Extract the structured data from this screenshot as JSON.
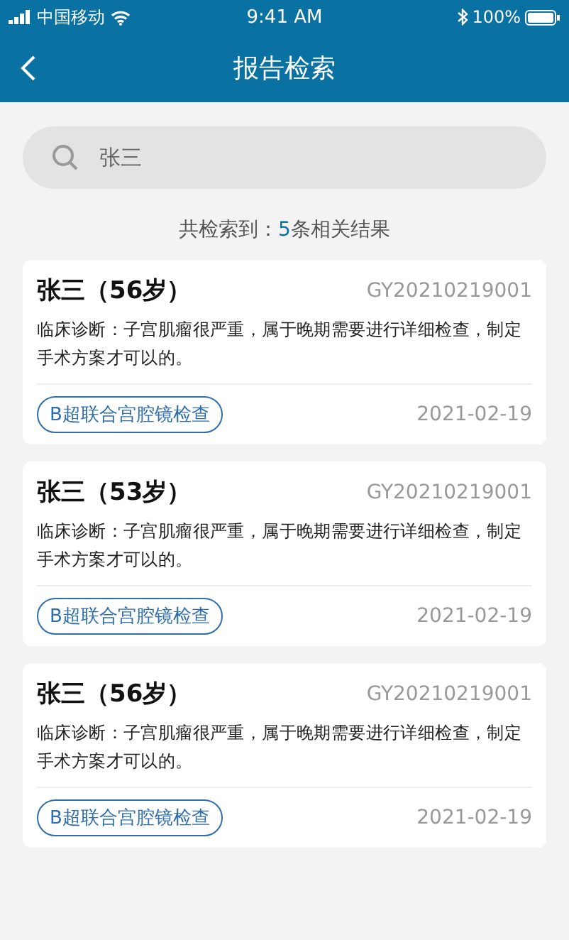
{
  "status_bar": {
    "carrier": "中国移动",
    "time": "9:41 AM",
    "battery": "100%"
  },
  "nav": {
    "title": "报告检索"
  },
  "search": {
    "value": "张三"
  },
  "summary": {
    "prefix": "共检索到：",
    "count": "5",
    "suffix": "条相关结果"
  },
  "results": [
    {
      "name": "张三（56岁）",
      "code": "GY20210219001",
      "diagnosis": "临床诊断：子宫肌瘤很严重，属于晚期需要进行详细检查，制定手术方案才可以的。",
      "tag": "B超联合宫腔镜检查",
      "date": "2021-02-19"
    },
    {
      "name": "张三（53岁）",
      "code": "GY20210219001",
      "diagnosis": "临床诊断：子宫肌瘤很严重，属于晚期需要进行详细检查，制定手术方案才可以的。",
      "tag": "B超联合宫腔镜检查",
      "date": "2021-02-19"
    },
    {
      "name": "张三（56岁）",
      "code": "GY20210219001",
      "diagnosis": "临床诊断：子宫肌瘤很严重，属于晚期需要进行详细检查，制定手术方案才可以的。",
      "tag": "B超联合宫腔镜检查",
      "date": "2021-02-19"
    }
  ]
}
